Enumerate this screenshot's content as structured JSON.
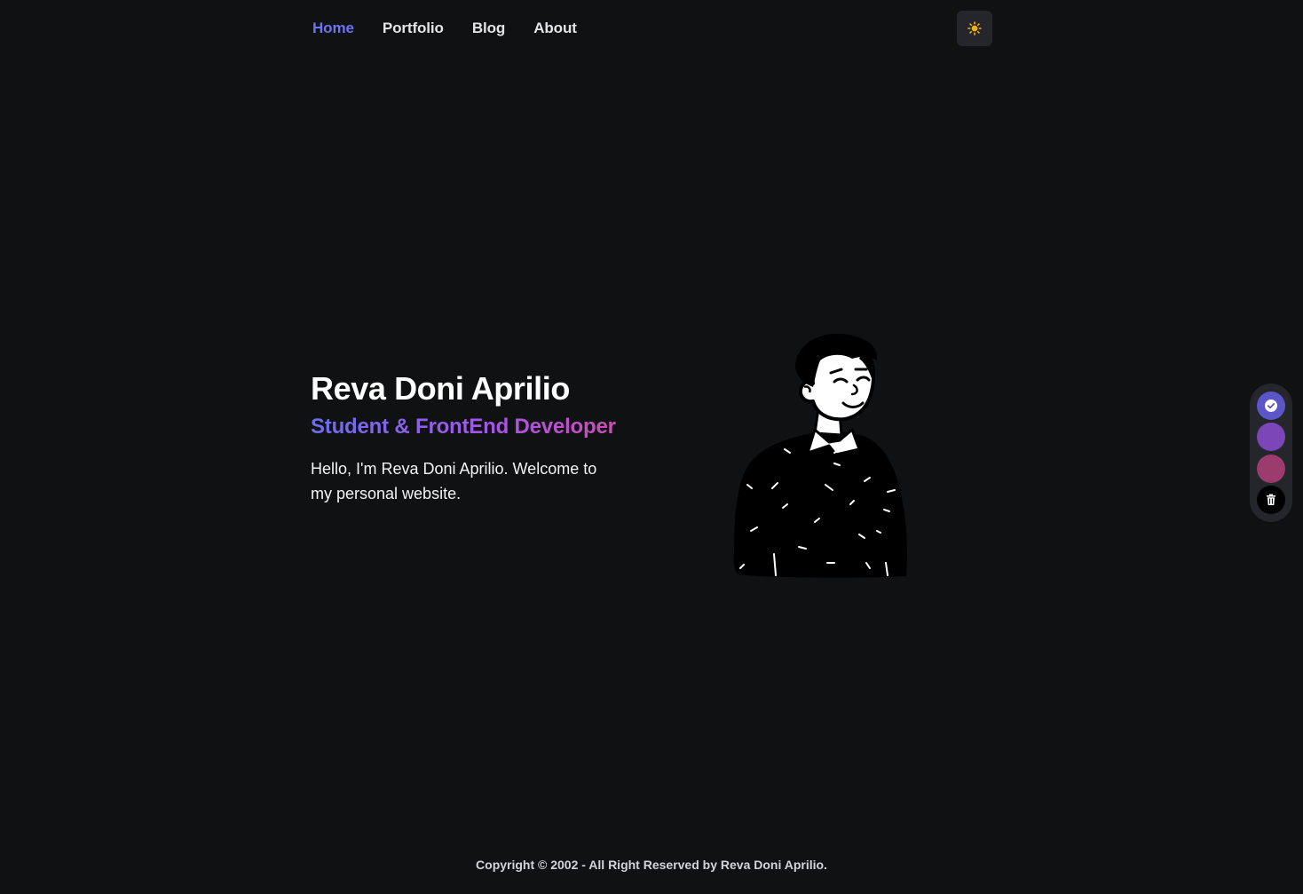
{
  "nav": {
    "items": [
      {
        "label": "Home",
        "active": true
      },
      {
        "label": "Portfolio",
        "active": false
      },
      {
        "label": "Blog",
        "active": false
      },
      {
        "label": "About",
        "active": false
      }
    ],
    "theme_toggle_icon": "sun-icon"
  },
  "hero": {
    "name": "Reva Doni Aprilio",
    "role": "Student & FrontEnd Developer",
    "description": "Hello, I'm Reva Doni Aprilio. Welcome to my personal website.",
    "illustration": "person-illustration"
  },
  "color_switcher": {
    "swatches": [
      {
        "color": "#5b55c9",
        "selected": true,
        "icon": "check-icon"
      },
      {
        "color": "#7b46b8",
        "selected": false
      },
      {
        "color": "#9c3c6e",
        "selected": false
      }
    ],
    "reset_icon": "trash-icon"
  },
  "footer": {
    "copyright": "Copyright © 2002 - All Right Reserved by Reva Doni Aprilio."
  },
  "colors": {
    "background": "#101113",
    "accent": "#6f73f0",
    "gradient_start": "#6b6ef0",
    "gradient_end": "#d84ba9",
    "theme_button_bg": "#25262b",
    "sun_icon": "#f5b301"
  }
}
